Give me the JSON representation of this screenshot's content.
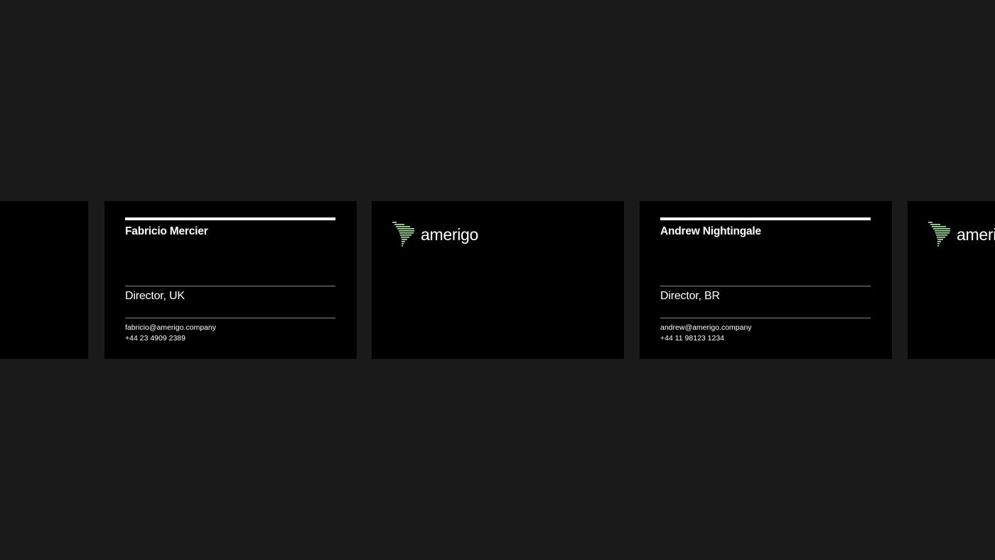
{
  "colors": {
    "background": "#1a1a1a",
    "card": "#000000",
    "text": "#ffffff",
    "accent": "#a8f0a0"
  },
  "brand": {
    "wordmark": "amerigo",
    "logo_icon": "south-america-stripes-icon"
  },
  "cards": [
    {
      "name": "Fabricio Mercier",
      "role": "Director, UK",
      "email": "fabricio@amerigo.company",
      "phone": "+44 23 4909 2389"
    },
    {
      "name": "Andrew Nightingale",
      "role": "Director, BR",
      "email": "andrew@amerigo.company",
      "phone": "+44 11 98123 1234"
    }
  ]
}
